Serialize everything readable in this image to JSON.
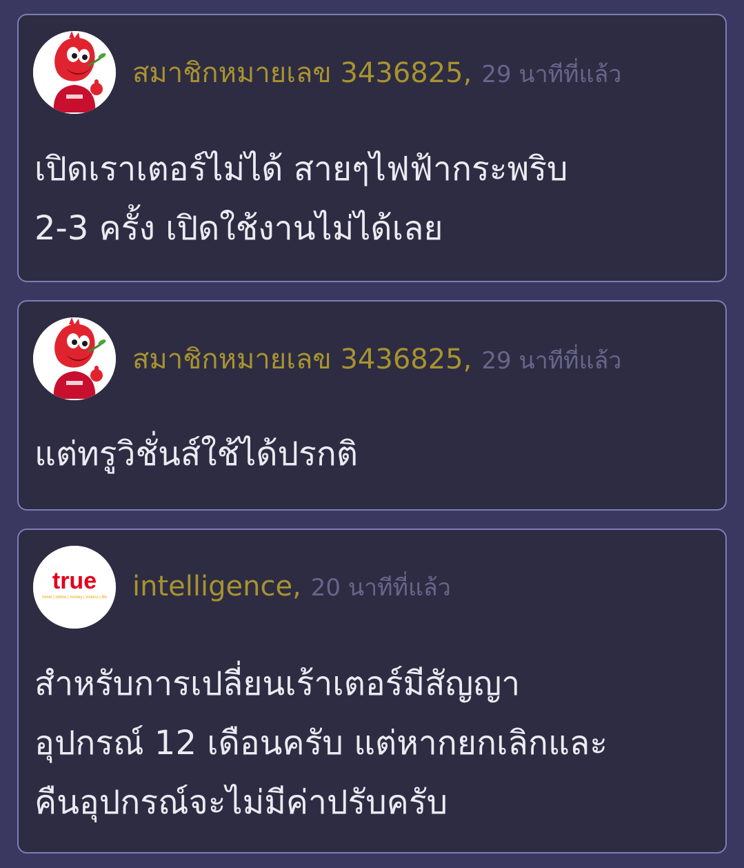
{
  "comments": [
    {
      "avatar": "liverpool-mascot-avatar",
      "author": "สมาชิกหมายเลข 3436825",
      "time": "29 นาทีที่แล้ว",
      "lines": [
        "เปิดเราเตอร์ไม่ได้ สายๆไฟฟ้ากระพริบ",
        "2-3 ครั้ง เปิดใช้งานไม่ได้เลย"
      ]
    },
    {
      "avatar": "liverpool-mascot-avatar",
      "author": "สมาชิกหมายเลข 3436825",
      "time": "29 นาทีที่แล้ว",
      "lines": [
        "แต่ทรูวิชั่นส์ใช้ได้ปรกติ"
      ]
    },
    {
      "avatar": "true-logo-avatar",
      "avatar_logo_text": "true",
      "avatar_logo_tagline": "move | online | money | visions | life",
      "author": "intelligence",
      "time": "20 นาทีที่แล้ว",
      "lines": [
        "สำหรับการเปลี่ยนเร้าเตอร์มีสัญญา",
        "อุปกรณ์ 12 เดือนครับ แต่หากยกเลิกและ",
        "คืนอุปกรณ์จะไม่มีค่าปรับครับ"
      ]
    }
  ],
  "colors": {
    "page_background": "#3a3860",
    "card_background": "#2e2c42",
    "card_border": "#7d7eb6",
    "author": "#a79330",
    "timestamp": "#66668c",
    "body_text": "#eceaf2",
    "true_brand_red": "#e3001b"
  }
}
